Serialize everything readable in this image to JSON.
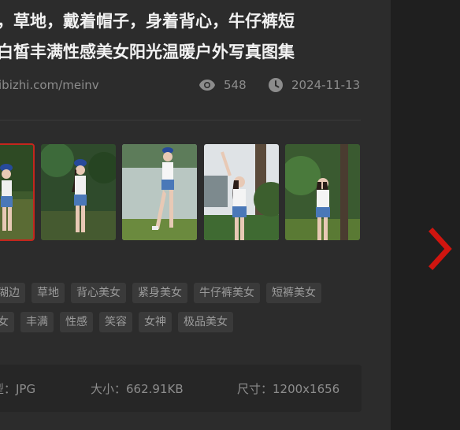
{
  "title": {
    "line1": "，草地，戴着帽子，身着背心，牛仔裤短",
    "line2": "白皙丰满性感美女阳光温暖户外写真图集"
  },
  "meta": {
    "source": "ibizhi.com/meinv",
    "views": "548",
    "date": "2024-11-13"
  },
  "thumbnails": [
    {
      "label": "photo-1",
      "active": true
    },
    {
      "label": "photo-2",
      "active": false
    },
    {
      "label": "photo-3",
      "active": false
    },
    {
      "label": "photo-4",
      "active": false
    },
    {
      "label": "photo-5",
      "active": false
    }
  ],
  "tags_row1": [
    "湖边",
    "草地",
    "背心美女",
    "紧身美女",
    "牛仔裤美女",
    "短裤美女"
  ],
  "tags_row2": [
    "女",
    "丰满",
    "性感",
    "笑容",
    "女神",
    "极品美女"
  ],
  "info": {
    "type": "型：JPG",
    "size": "大小：662.91KB",
    "dimensions": "尺寸：1200x1656"
  },
  "icons": {
    "views": "eye-icon",
    "date": "clock-icon",
    "next": "chevron-right-icon"
  },
  "colors": {
    "accent": "#c4261d",
    "background": "#2c2c2c",
    "tag_bg": "#3a3a3a"
  }
}
